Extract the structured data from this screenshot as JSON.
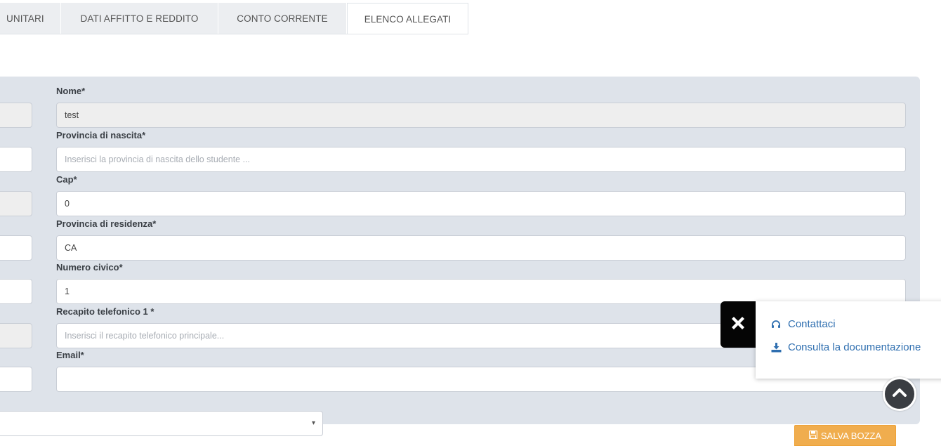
{
  "tabs": [
    {
      "label": "UNITARI",
      "active": false
    },
    {
      "label": "DATI AFFITTO E REDDITO",
      "active": false
    },
    {
      "label": "CONTO CORRENTE",
      "active": false
    },
    {
      "label": "ELENCO ALLEGATI",
      "active": true
    }
  ],
  "form": {
    "nome": {
      "label": "Nome*",
      "value": "test",
      "readonly": true
    },
    "provincia_nascita": {
      "label": "Provincia di nascita*",
      "placeholder": "Inserisci la provincia di nascita dello studente ..."
    },
    "cap": {
      "label": "Cap*",
      "value": "0"
    },
    "provincia_residenza": {
      "label": "Provincia di residenza*",
      "value": "CA"
    },
    "numero_civico": {
      "label": "Numero civico*",
      "value": "1"
    },
    "recapito_telefonico": {
      "label": "Recapito telefonico 1 *",
      "placeholder": "Inserisci il recapito telefonico principale..."
    },
    "email": {
      "label": "Email*",
      "value": ""
    },
    "select_arrow": "▾"
  },
  "actions": {
    "save_draft": "SALVA BOZZA"
  },
  "help_widget": {
    "contact_label": "Contattaci",
    "docs_label": "Consulta la documentazione"
  },
  "colors": {
    "panel_bg": "#dee3ea",
    "save_button": "#f0ad4e",
    "link": "#2f6fb0",
    "close_bg": "#050505"
  },
  "icons": {
    "close": "close-icon",
    "contact": "headset-icon",
    "docs": "download-icon",
    "scroll_up": "chevron-up-icon",
    "save": "floppy-disk-icon"
  }
}
